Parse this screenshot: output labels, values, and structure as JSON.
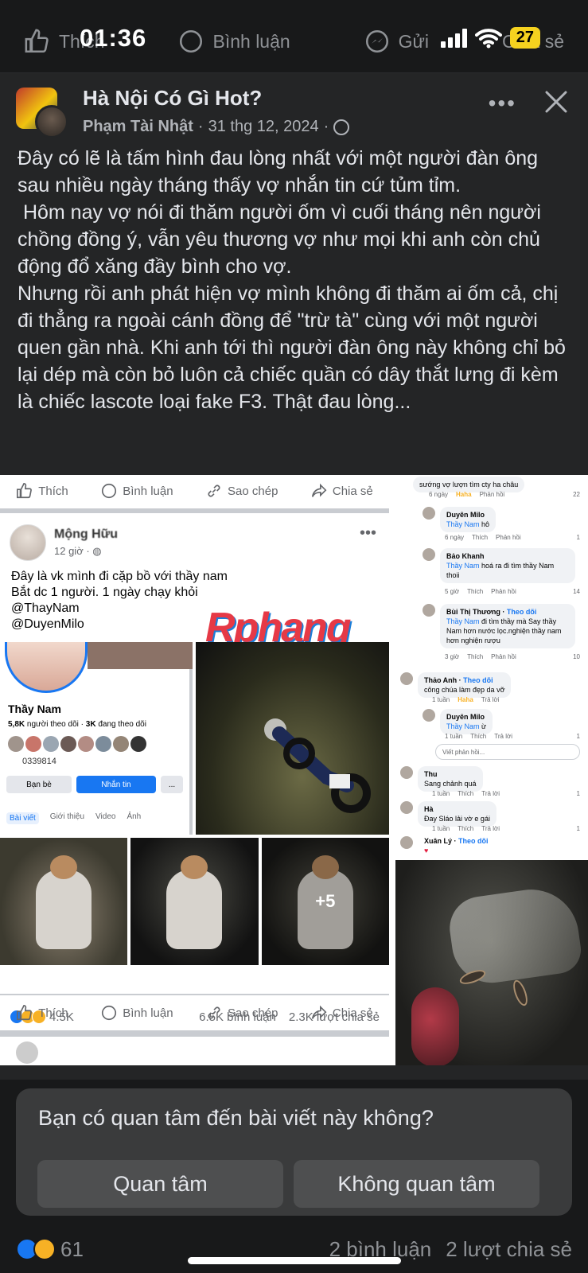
{
  "status_bar": {
    "time": "01:36",
    "battery": "27"
  },
  "top_actions": {
    "like": "Thích",
    "comment": "Bình luận",
    "send": "Gửi",
    "share": "Chia sẻ"
  },
  "post": {
    "page_name": "Hà Nội Có Gì Hot?",
    "author": "Phạm Tài Nhật",
    "date": "31 thg 12, 2024",
    "text": "Đây có lẽ là tấm hình đau lòng nhất với một người đàn ông sau nhiều ngày tháng thấy vợ nhắn tin cứ tủm tỉm.\n Hôm nay vợ nói đi thăm người ốm vì cuối tháng nên người chồng đồng ý, vẫn yêu thương vợ như mọi khi anh còn chủ động đổ xăng đầy bình cho vợ.\nNhưng rồi anh phát hiện vợ mình không đi thăm ai ốm cả, chị đi thẳng ra ngoài cánh đồng để \"trừ tà\" cùng với một người quen gần nhà. Khi anh tới thì người đàn ông này không chỉ bỏ lại dép mà còn bỏ luôn cả chiếc quần có dây thắt lưng đi kèm là chiếc lascote loại fake F3. Thật đau lòng..."
  },
  "collage": {
    "action_bar": {
      "like": "Thích",
      "comment": "Bình luận",
      "copy": "Sao chép",
      "share": "Chia sẻ"
    },
    "inner_post": {
      "name": "Mộng Hữu",
      "time": "12 giờ",
      "text": "Đây là vk mình đi cặp bồ với thầy nam\nBắt dc 1 người. 1 ngày chạy khỏi\n@ThayNam\n@DuyenMilo"
    },
    "watermark": "Rphang",
    "profile": {
      "name": "Thầy Nam",
      "followers": "5,8K",
      "followers_label": "người theo dõi",
      "following": "3K",
      "following_label": "đang theo dõi",
      "partial_id": "0339814",
      "btn_friends": "Bạn bè",
      "btn_message": "Nhắn tin",
      "btn_more": "...",
      "tabs": [
        "Bài viết",
        "Giới thiệu",
        "Video",
        "Ảnh"
      ]
    },
    "more_photos": "+5",
    "reactions": {
      "count": "4.5K",
      "comments": "6.5K bình luận",
      "shares": "2.3K lượt chia sẻ"
    },
    "comments_top": [
      {
        "text": "sướng vợ lượn tìm cty ha châu"
      },
      {
        "meta": [
          "6 ngày",
          "Haha",
          "Phản hồi"
        ],
        "count": "22"
      },
      {
        "name": "Duyên Milo",
        "tag": "Thầy Nam",
        "text": "hô",
        "meta": [
          "6 ngày",
          "Thích",
          "Phản hồi"
        ],
        "count": "1"
      },
      {
        "name": "Bảo Khanh",
        "tag": "Thầy Nam",
        "text": "hoá ra đi tìm thầy Nam thoii",
        "meta": [
          "5 giờ",
          "Thích",
          "Phản hồi"
        ],
        "count": "14"
      },
      {
        "name": "Bùi Thị Thương",
        "follow": "Theo dõi",
        "tag": "Thầy Nam",
        "text": "đi tìm thầy mà Say thầy Nam hơn nước lọc.nghiện thầy nam hơn nghiện rượu",
        "meta": [
          "3 giờ",
          "Thích",
          "Phản hồi"
        ],
        "count": "10"
      }
    ],
    "comments_mid": [
      {
        "name": "Thảo Anh",
        "follow": "Theo dõi",
        "text": "công chúa làm đẹp da vỡ",
        "meta": [
          "1 tuần",
          "Haha",
          "Trả lời"
        ]
      },
      {
        "name": "Duyên Milo",
        "tag": "Thầy Nam",
        "text": "ừ",
        "meta": [
          "1 tuần",
          "Thích",
          "Trả lời"
        ],
        "count": "1"
      },
      {
        "reply_placeholder": "Viết phản hồi..."
      },
      {
        "name": "Thu",
        "text": "Sang chảnh quá",
        "meta": [
          "1 tuần",
          "Thích",
          "Trả lời"
        ],
        "count": "1"
      },
      {
        "name": "Hà",
        "text": "Đay Sláo lải vờ e gái",
        "meta": [
          "1 tuần",
          "Thích",
          "Trả lời"
        ],
        "count": "1"
      },
      {
        "name": "Xuân Lý",
        "follow": "Theo dõi",
        "text": ""
      }
    ]
  },
  "interest_prompt": {
    "question": "Bạn có quan tâm đến bài viết này không?",
    "yes": "Quan tâm",
    "no": "Không quan tâm"
  },
  "bottom_stats": {
    "reactions": "61",
    "comments": "2 bình luận",
    "shares": "2 lượt chia sẻ"
  },
  "colors": {
    "background": "#18191a",
    "card": "#242526",
    "accent": "#1877f2",
    "haha": "#f7b125"
  }
}
